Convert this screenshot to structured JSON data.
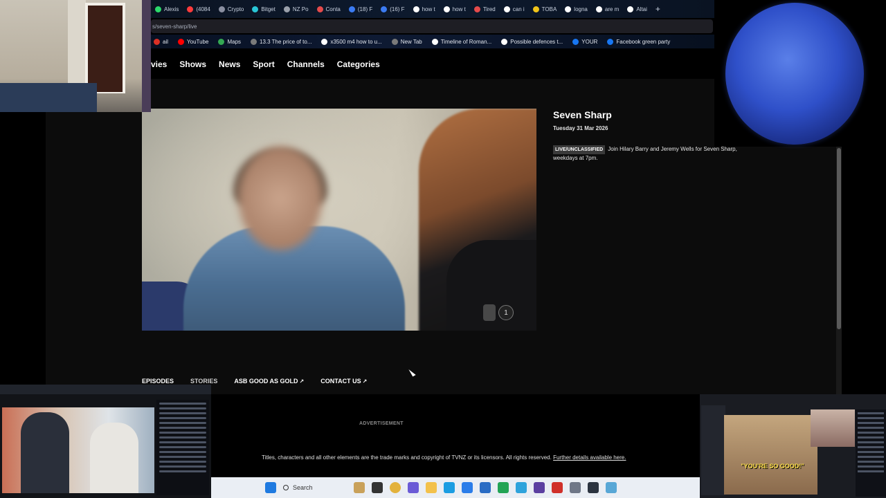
{
  "browser": {
    "tabs": [
      {
        "label": "Alexis",
        "color": "#2bd96b"
      },
      {
        "label": "(4084",
        "color": "#ff3b3b"
      },
      {
        "label": "Crypto",
        "color": "#8a8fa0"
      },
      {
        "label": "Bitget",
        "color": "#29c6d6"
      },
      {
        "label": "NZ Po",
        "color": "#9aa0aa"
      },
      {
        "label": "Conta",
        "color": "#e54b4b"
      },
      {
        "label": "(18) F",
        "color": "#3b7bf2"
      },
      {
        "label": "(16) F",
        "color": "#3b7bf2"
      },
      {
        "label": "how t",
        "color": "#ffffff"
      },
      {
        "label": "how t",
        "color": "#ffffff"
      },
      {
        "label": "Tired",
        "color": "#e54b4b"
      },
      {
        "label": "can i",
        "color": "#ffffff"
      },
      {
        "label": "TOBA",
        "color": "#f0c419"
      },
      {
        "label": "logna",
        "color": "#ffffff"
      },
      {
        "label": "are m",
        "color": "#ffffff"
      },
      {
        "label": "Altai",
        "color": "#ffffff"
      }
    ],
    "add_tab": "+",
    "address": "s/seven-sharp/live",
    "bookmarks": [
      {
        "label": "ail",
        "color": "#d93025"
      },
      {
        "label": "YouTube",
        "color": "#ff0000"
      },
      {
        "label": "Maps",
        "color": "#34a853"
      },
      {
        "label": "13.3 The price of to...",
        "color": "#7a7a7a"
      },
      {
        "label": "x3500 m4 how to u...",
        "color": "#ffffff"
      },
      {
        "label": "New Tab",
        "color": "#7a7a7a"
      },
      {
        "label": "Timeline of Roman...",
        "color": "#ffffff"
      },
      {
        "label": "Possible defences t...",
        "color": "#ffffff"
      },
      {
        "label": "YOUR",
        "color": "#1877f2"
      },
      {
        "label": "Facebook green party",
        "color": "#1877f2"
      }
    ]
  },
  "site": {
    "nav": [
      "vies",
      "Shows",
      "News",
      "Sport",
      "Channels",
      "Categories"
    ],
    "show_title": "Seven Sharp",
    "show_date": "Tuesday 31 Mar 2026",
    "badge": "LIVE/UNCLASSIFIED",
    "description": "Join Hilary Barry and Jeremy Wells for Seven Sharp, weekdays at 7pm.",
    "rating_number": "1",
    "lower_tabs": [
      "EPISODES",
      "STORIES",
      "ASB GOOD AS GOLD",
      "CONTACT US"
    ],
    "advertisement": "ADVERTISEMENT",
    "legal_text": "Titles, characters and all other elements are the trade marks and copyright of TVNZ or its licensors. All rights reserved.",
    "legal_link": "Further details available here."
  },
  "taskbar": {
    "search_label": "Search"
  },
  "overlay": {
    "caption": "\"YOU'RE SO GOOD!\""
  }
}
